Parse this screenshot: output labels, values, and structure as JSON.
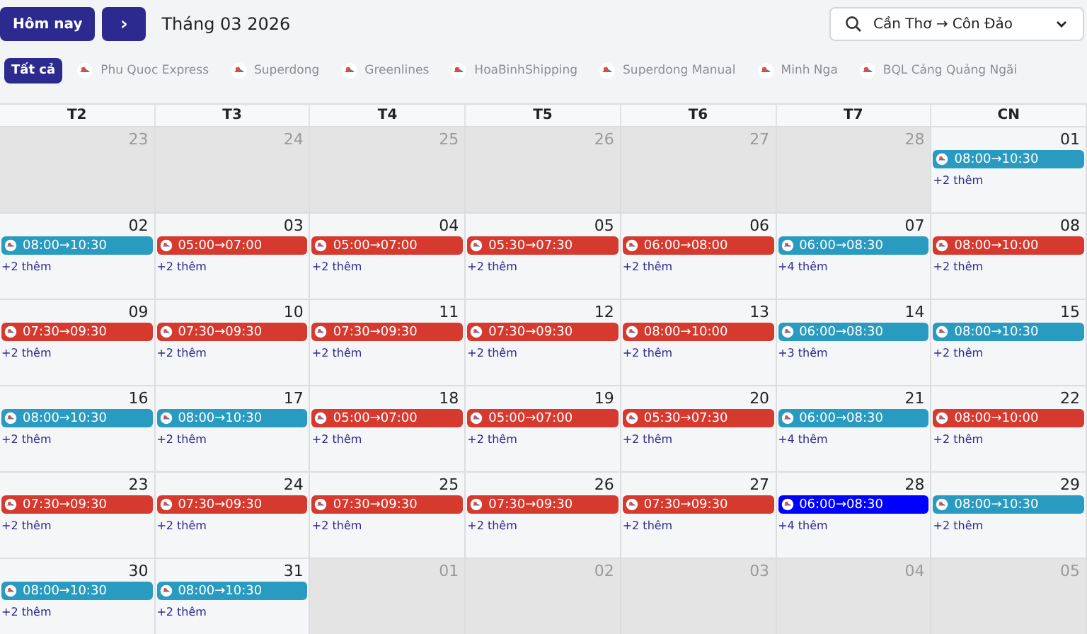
{
  "toolbar": {
    "today_button": "Hôm nay",
    "next_button": "›",
    "month_title": "Tháng 03 2026",
    "route_select": {
      "value": "Cần Thơ → Côn Đảo"
    }
  },
  "filters": [
    {
      "label": "Tất cả",
      "selected": true,
      "kind": "text"
    },
    {
      "label": "Phu Quoc Express",
      "selected": false,
      "kind": "logo"
    },
    {
      "label": "Superdong",
      "selected": false,
      "kind": "logo"
    },
    {
      "label": "Greenlines",
      "selected": false,
      "kind": "logo"
    },
    {
      "label": "HoaBinhShipping",
      "selected": false,
      "kind": "logo"
    },
    {
      "label": "Superdong Manual",
      "selected": false,
      "kind": "logo"
    },
    {
      "label": "Minh Nga",
      "selected": false,
      "kind": "logo"
    },
    {
      "label": "BQL Cảng Quảng Ngãi",
      "selected": false,
      "kind": "logo"
    }
  ],
  "calendar": {
    "weekdays": [
      "T2",
      "T3",
      "T4",
      "T5",
      "T6",
      "T7",
      "CN"
    ],
    "weeks": [
      [
        {
          "day": "23",
          "outside": true
        },
        {
          "day": "24",
          "outside": true
        },
        {
          "day": "25",
          "outside": true
        },
        {
          "day": "26",
          "outside": true
        },
        {
          "day": "27",
          "outside": true
        },
        {
          "day": "28",
          "outside": true
        },
        {
          "day": "01",
          "outside": false,
          "event": {
            "time": "08:00→10:30",
            "color": "#2a9bc0"
          },
          "more": "+2 thêm"
        }
      ],
      [
        {
          "day": "02",
          "outside": false,
          "event": {
            "time": "08:00→10:30",
            "color": "#2a9bc0"
          },
          "more": "+2 thêm"
        },
        {
          "day": "03",
          "outside": false,
          "event": {
            "time": "05:00→07:00",
            "color": "#d63a2f"
          },
          "more": "+2 thêm"
        },
        {
          "day": "04",
          "outside": false,
          "event": {
            "time": "05:00→07:00",
            "color": "#d63a2f"
          },
          "more": "+2 thêm"
        },
        {
          "day": "05",
          "outside": false,
          "event": {
            "time": "05:30→07:30",
            "color": "#d63a2f"
          },
          "more": "+2 thêm"
        },
        {
          "day": "06",
          "outside": false,
          "event": {
            "time": "06:00→08:00",
            "color": "#d63a2f"
          },
          "more": "+2 thêm"
        },
        {
          "day": "07",
          "outside": false,
          "event": {
            "time": "06:00→08:30",
            "color": "#2a9bc0"
          },
          "more": "+4 thêm"
        },
        {
          "day": "08",
          "outside": false,
          "event": {
            "time": "08:00→10:00",
            "color": "#d63a2f"
          },
          "more": "+2 thêm"
        }
      ],
      [
        {
          "day": "09",
          "outside": false,
          "event": {
            "time": "07:30→09:30",
            "color": "#d63a2f"
          },
          "more": "+2 thêm"
        },
        {
          "day": "10",
          "outside": false,
          "event": {
            "time": "07:30→09:30",
            "color": "#d63a2f"
          },
          "more": "+2 thêm"
        },
        {
          "day": "11",
          "outside": false,
          "event": {
            "time": "07:30→09:30",
            "color": "#d63a2f"
          },
          "more": "+2 thêm"
        },
        {
          "day": "12",
          "outside": false,
          "event": {
            "time": "07:30→09:30",
            "color": "#d63a2f"
          },
          "more": "+2 thêm"
        },
        {
          "day": "13",
          "outside": false,
          "event": {
            "time": "08:00→10:00",
            "color": "#d63a2f"
          },
          "more": "+2 thêm"
        },
        {
          "day": "14",
          "outside": false,
          "event": {
            "time": "06:00→08:30",
            "color": "#2a9bc0"
          },
          "more": "+3 thêm"
        },
        {
          "day": "15",
          "outside": false,
          "event": {
            "time": "08:00→10:30",
            "color": "#2a9bc0"
          },
          "more": "+2 thêm"
        }
      ],
      [
        {
          "day": "16",
          "outside": false,
          "event": {
            "time": "08:00→10:30",
            "color": "#2a9bc0"
          },
          "more": "+2 thêm"
        },
        {
          "day": "17",
          "outside": false,
          "event": {
            "time": "08:00→10:30",
            "color": "#2a9bc0"
          },
          "more": "+2 thêm"
        },
        {
          "day": "18",
          "outside": false,
          "event": {
            "time": "05:00→07:00",
            "color": "#d63a2f"
          },
          "more": "+2 thêm"
        },
        {
          "day": "19",
          "outside": false,
          "event": {
            "time": "05:00→07:00",
            "color": "#d63a2f"
          },
          "more": "+2 thêm"
        },
        {
          "day": "20",
          "outside": false,
          "event": {
            "time": "05:30→07:30",
            "color": "#d63a2f"
          },
          "more": "+2 thêm"
        },
        {
          "day": "21",
          "outside": false,
          "event": {
            "time": "06:00→08:30",
            "color": "#2a9bc0"
          },
          "more": "+4 thêm"
        },
        {
          "day": "22",
          "outside": false,
          "event": {
            "time": "08:00→10:00",
            "color": "#d63a2f"
          },
          "more": "+2 thêm"
        }
      ],
      [
        {
          "day": "23",
          "outside": false,
          "event": {
            "time": "07:30→09:30",
            "color": "#d63a2f"
          },
          "more": "+2 thêm"
        },
        {
          "day": "24",
          "outside": false,
          "event": {
            "time": "07:30→09:30",
            "color": "#d63a2f"
          },
          "more": "+2 thêm"
        },
        {
          "day": "25",
          "outside": false,
          "event": {
            "time": "07:30→09:30",
            "color": "#d63a2f"
          },
          "more": "+2 thêm"
        },
        {
          "day": "26",
          "outside": false,
          "event": {
            "time": "07:30→09:30",
            "color": "#d63a2f"
          },
          "more": "+2 thêm"
        },
        {
          "day": "27",
          "outside": false,
          "event": {
            "time": "07:30→09:30",
            "color": "#d63a2f"
          },
          "more": "+2 thêm"
        },
        {
          "day": "28",
          "outside": false,
          "event": {
            "time": "06:00→08:30",
            "color": "#0000ff"
          },
          "more": "+4 thêm"
        },
        {
          "day": "29",
          "outside": false,
          "event": {
            "time": "08:00→10:30",
            "color": "#2a9bc0"
          },
          "more": "+2 thêm"
        }
      ],
      [
        {
          "day": "30",
          "outside": false,
          "event": {
            "time": "08:00→10:30",
            "color": "#2a9bc0"
          },
          "more": "+2 thêm"
        },
        {
          "day": "31",
          "outside": false,
          "event": {
            "time": "08:00→10:30",
            "color": "#2a9bc0"
          },
          "more": "+2 thêm"
        },
        {
          "day": "01",
          "outside": true
        },
        {
          "day": "02",
          "outside": true
        },
        {
          "day": "03",
          "outside": true
        },
        {
          "day": "04",
          "outside": true
        },
        {
          "day": "05",
          "outside": true
        }
      ]
    ]
  }
}
